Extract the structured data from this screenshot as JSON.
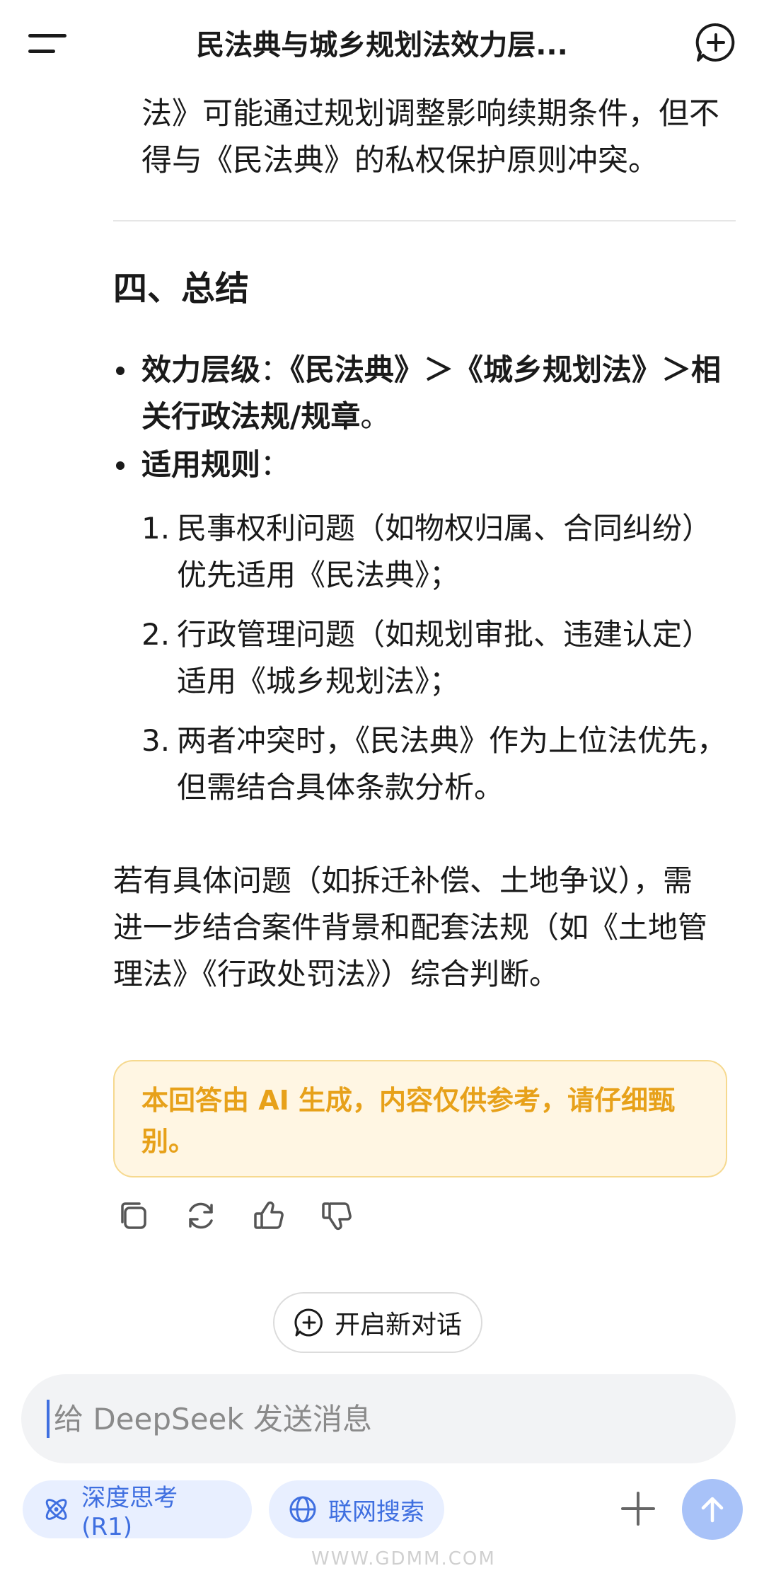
{
  "header": {
    "title": "民法典与城乡规划法效力层..."
  },
  "content": {
    "para_top": "法》可能通过规划调整影响续期条件，但不得与《民法典》的私权保护原则冲突。",
    "section_heading": "四、总结",
    "bullets": [
      {
        "label": "效力层级",
        "sep": "：",
        "text": "《民法典》＞《城乡规划法》＞相关行政法规/规章",
        "end": "。"
      },
      {
        "label": "适用规则",
        "sep": "："
      }
    ],
    "rules": [
      {
        "num": "1.",
        "text": "民事权利问题（如物权归属、合同纠纷）优先适用《民法典》；"
      },
      {
        "num": "2.",
        "text": "行政管理问题（如规划审批、违建认定）适用《城乡规划法》；"
      },
      {
        "num": "3.",
        "text": "两者冲突时，《民法典》作为上位法优先，但需结合具体条款分析。"
      }
    ],
    "para_bottom": "若有具体问题（如拆迁补偿、土地争议），需进一步结合案件背景和配套法规（如《土地管理法》《行政处罚法》）综合判断。",
    "notice": "本回答由 AI 生成，内容仅供参考，请仔细甄别。"
  },
  "actions": {
    "icons": [
      "copy-icon",
      "regenerate-icon",
      "thumbs-up-icon",
      "thumbs-down-icon"
    ]
  },
  "new_chat": {
    "label": "开启新对话"
  },
  "input": {
    "placeholder": "给 DeepSeek 发送消息"
  },
  "toolbar": {
    "deep_think": "深度思考 (R1)",
    "web_search": "联网搜索"
  },
  "watermark": "WWW.GDMM.COM",
  "colors": {
    "accent": "#3f6fe0",
    "chip_bg": "#e8efff",
    "notice_bg": "#fff6e3",
    "notice_text": "#e7a11a",
    "send_bg": "#a8c2f8"
  }
}
